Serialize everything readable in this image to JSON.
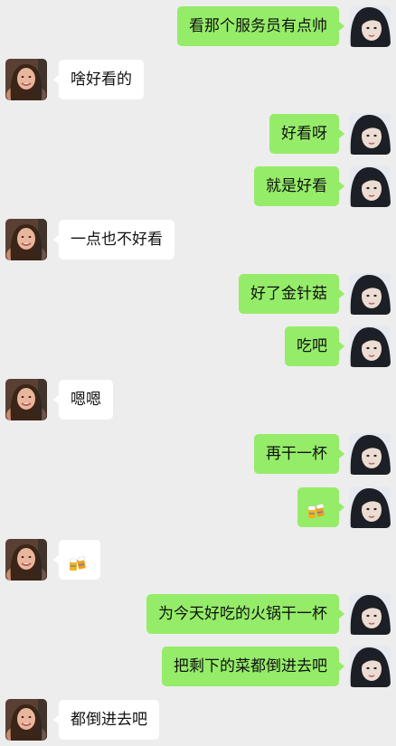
{
  "messages": [
    {
      "side": "right",
      "text": "看那个服务员有点帅"
    },
    {
      "side": "left",
      "text": "啥好看的"
    },
    {
      "side": "right",
      "text": "好看呀"
    },
    {
      "side": "right",
      "text": "就是好看"
    },
    {
      "side": "left",
      "text": "一点也不好看"
    },
    {
      "side": "right",
      "text": "好了金针菇"
    },
    {
      "side": "right",
      "text": "吃吧"
    },
    {
      "side": "left",
      "text": "嗯嗯"
    },
    {
      "side": "right",
      "text": "再干一杯"
    },
    {
      "side": "right",
      "type": "emoji",
      "icon": "beer-cheers-emoji"
    },
    {
      "side": "left",
      "type": "emoji",
      "icon": "beer-cheers-emoji"
    },
    {
      "side": "right",
      "text": "为今天好吃的火锅干一杯"
    },
    {
      "side": "right",
      "text": "把剩下的菜都倒进去吧"
    },
    {
      "side": "left",
      "text": "都倒进去吧"
    }
  ],
  "colors": {
    "background": "#ededed",
    "self_bubble": "#95ec69",
    "other_bubble": "#ffffff"
  }
}
